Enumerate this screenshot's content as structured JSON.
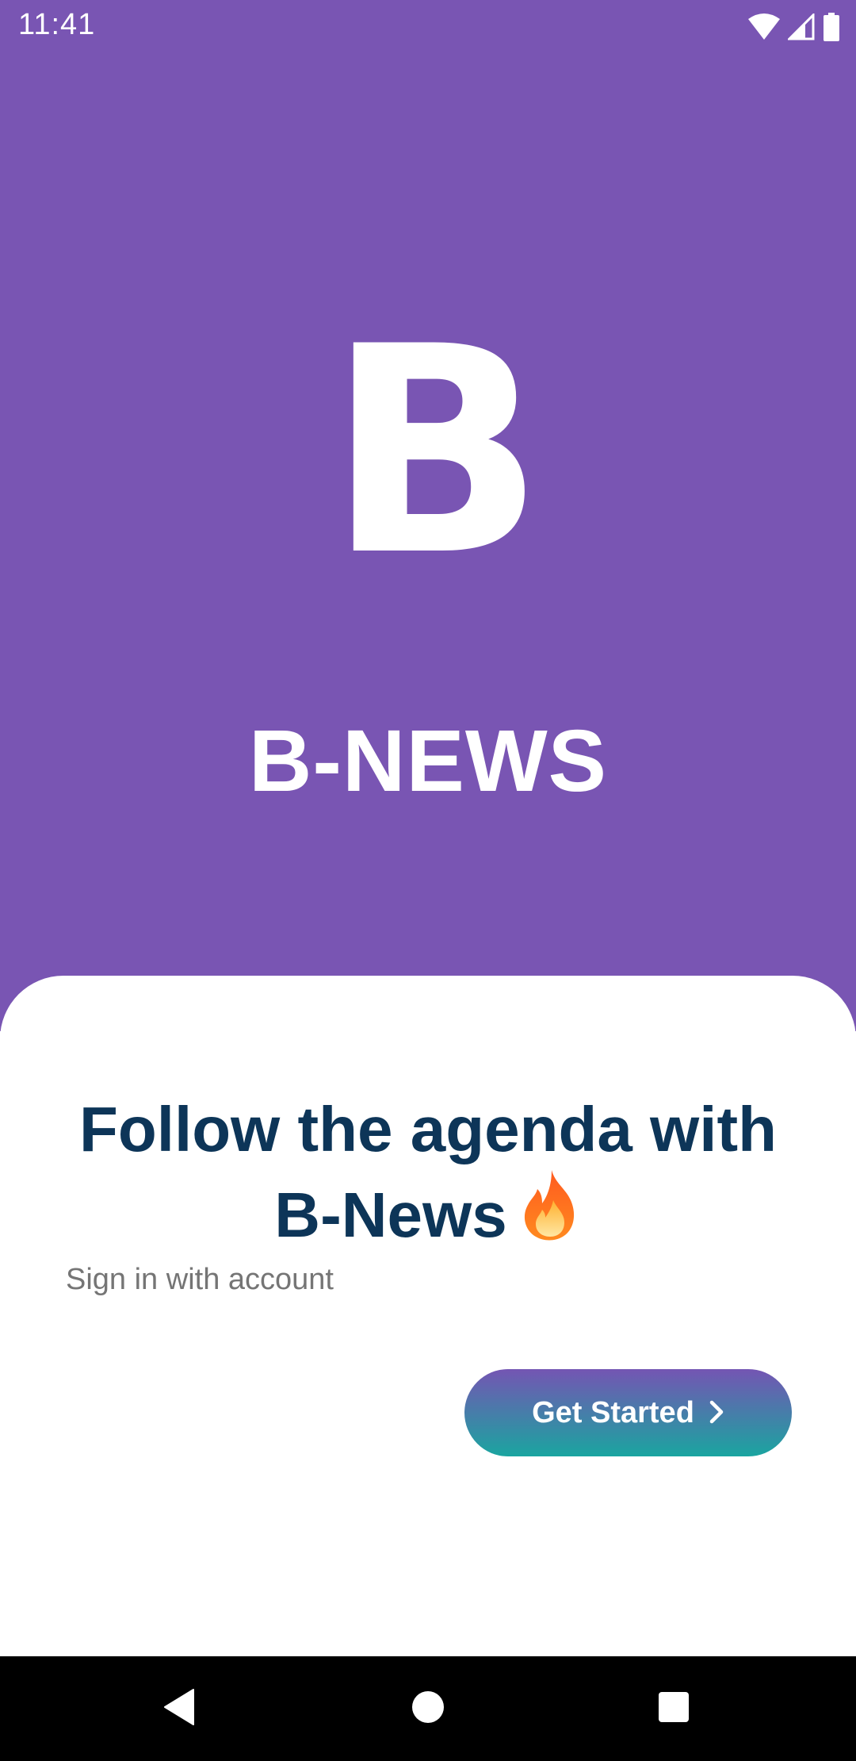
{
  "status_bar": {
    "time": "11:41",
    "icons": [
      "wifi-icon",
      "cell-signal-icon",
      "battery-icon"
    ]
  },
  "hero": {
    "logo_letter": "B",
    "app_name": "B-NEWS",
    "background_color": "#7955b3"
  },
  "onboarding": {
    "headline": "Follow the agenda with B-News",
    "headline_icon": "fire-icon",
    "subtitle": "Sign in with account",
    "cta_label": "Get Started",
    "cta_icon": "chevron-right-icon",
    "headline_color": "#0d3558",
    "cta_gradient": [
      "#7455b3",
      "#1aa5a0"
    ]
  },
  "navigation_bar": {
    "buttons": [
      "back-icon",
      "home-icon",
      "recents-icon"
    ]
  }
}
